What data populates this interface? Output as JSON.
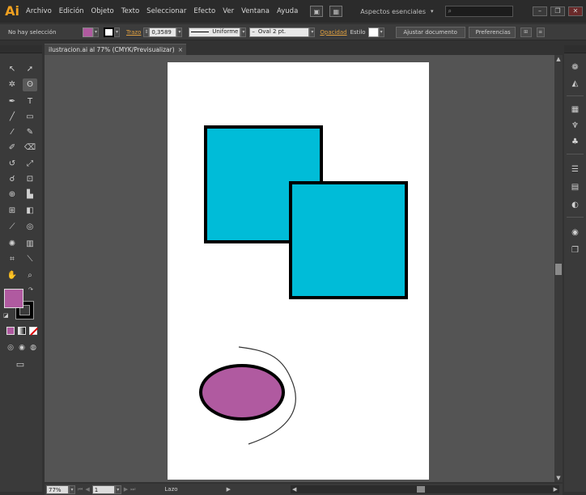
{
  "app": {
    "logo": "Ai",
    "menu": [
      "Archivo",
      "Edición",
      "Objeto",
      "Texto",
      "Seleccionar",
      "Efecto",
      "Ver",
      "Ventana",
      "Ayuda"
    ],
    "workspace": "Aspectos esenciales",
    "search_placeholder": "",
    "window_controls": [
      "–",
      "❐",
      "✕"
    ]
  },
  "control_bar": {
    "selection_status": "No hay selección",
    "fill_color": "#b05aa0",
    "stroke_label": "Trazo",
    "stroke_weight": "0,3589",
    "stroke_profile": "Uniforme",
    "brush": "Oval 2 pt.",
    "opacity_label": "Opacidad",
    "style_label": "Estilo",
    "adjust_document_button": "Ajustar documento",
    "preferences_button": "Preferencias"
  },
  "document": {
    "tab_title": "ilustracion.ai al 77% (CMYK/Previsualizar)",
    "artboard_color": "#ffffff",
    "shapes": [
      {
        "name": "square-1",
        "fill": "#00bcd8",
        "stroke": "#000000"
      },
      {
        "name": "square-2",
        "fill": "#00bcd8",
        "stroke": "#000000"
      },
      {
        "name": "ellipse",
        "fill": "#b05aa0",
        "stroke": "#000000"
      },
      {
        "name": "freehand-curve",
        "fill": "none",
        "stroke": "#333333"
      }
    ]
  },
  "tools_panel": {
    "fill_swatch": "#b05aa0",
    "stroke_swatch": "#000000",
    "tools": [
      "selection",
      "direct-selection",
      "magic-wand",
      "lasso",
      "pen",
      "type",
      "line",
      "rectangle",
      "paintbrush",
      "pencil",
      "blob-brush",
      "eraser",
      "rotate",
      "scale",
      "warp",
      "free-transform",
      "shape-builder",
      "perspective-grid",
      "mesh",
      "gradient",
      "eyedropper",
      "blend",
      "symbol-sprayer",
      "column-graph",
      "artboard",
      "slice",
      "hand",
      "zoom"
    ]
  },
  "status_bar": {
    "zoom": "77%",
    "artboard_number": "1",
    "current_tool": "Lazo"
  }
}
